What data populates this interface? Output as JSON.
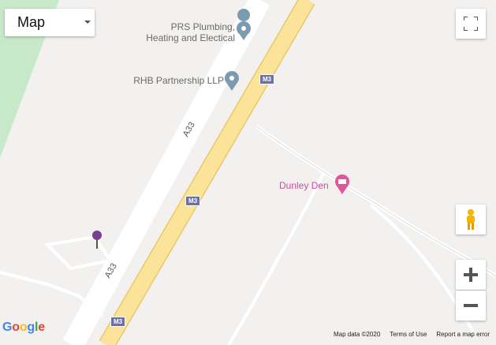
{
  "controls": {
    "map_type_label": "Map"
  },
  "places": {
    "prs": {
      "line1": "PRS Plumbing,",
      "line2": "Heating and Electical"
    },
    "rhb": "RHB Partnership LLP",
    "dunley": "Dunley Den"
  },
  "roads": {
    "a33_upper": "A33",
    "a33_lower": "A33",
    "m3_top": "M3",
    "m3_mid": "M3",
    "m3_bottom": "M3"
  },
  "footer": {
    "map_data": "Map data ©2020",
    "terms": "Terms of Use",
    "report": "Report a map error"
  },
  "brand": {
    "google_colors": [
      "#4285F4",
      "#EA4335",
      "#FBBC05",
      "#4285F4",
      "#34A853",
      "#EA4335"
    ],
    "google_letters": [
      "G",
      "o",
      "o",
      "g",
      "l",
      "e"
    ]
  },
  "colors": {
    "motorway": "#fbe49a",
    "park": "#c8e9c9",
    "pin": "#7b3f8f",
    "poi_gray": "#7b9bb0",
    "poi_pink": "#e0569a"
  }
}
